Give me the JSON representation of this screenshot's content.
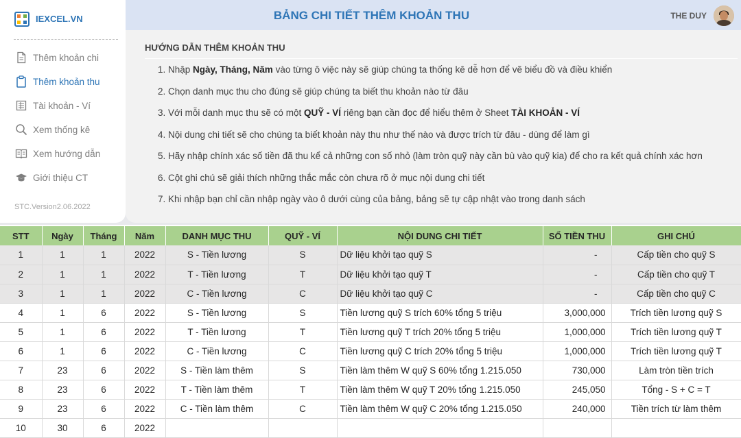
{
  "brand": {
    "name": "IEXCEL.VN"
  },
  "sidebar": {
    "items": [
      {
        "label": "Thêm khoản chi",
        "icon": "document-icon"
      },
      {
        "label": "Thêm khoản thu",
        "icon": "clipboard-icon",
        "active": true
      },
      {
        "label": "Tài khoản - Ví",
        "icon": "ledger-icon"
      },
      {
        "label": "Xem thống kê",
        "icon": "search-icon"
      },
      {
        "label": "Xem hướng dẫn",
        "icon": "book-icon"
      },
      {
        "label": "Giới thiệu CT",
        "icon": "graduation-cap-icon"
      }
    ],
    "version": "STC.Version2.06.2022"
  },
  "header": {
    "title": "BẢNG CHI TIẾT THÊM KHOẢN THU",
    "user": "THE DUY"
  },
  "guide": {
    "title": "HƯỚNG DẪN THÊM KHOẢN THU",
    "items": [
      [
        "1. Nhập ",
        "Ngày, Tháng, Năm",
        " vào từng ô việc này sẽ giúp chúng ta thống kê dễ hơn để vẽ biểu đồ và điều khiển"
      ],
      [
        "2. Chọn danh mục thu cho đúng sẽ giúp chúng ta biết thu khoản nào từ đâu"
      ],
      [
        "3. Với mỗi danh mục thu sẽ có một ",
        "QUỸ - VÍ",
        " riêng bạn cần đọc để hiểu thêm ở Sheet ",
        "TÀI KHOẢN - VÍ"
      ],
      [
        "4. Nội dung chi tiết sẽ cho chúng ta biết khoản này thu như thế nào và được trích từ đâu - dùng để làm gì"
      ],
      [
        "5. Hãy nhập chính xác số tiền đã thu kể cả những con số nhỏ (làm tròn quỹ này cần bù vào quỹ kia) để cho ra kết quả chính xác hơn"
      ],
      [
        "6. Cột ghi chú sẽ giải thích những thắc mắc còn chưa rõ ở mục nội dung chi tiết"
      ],
      [
        "7. Khi nhập bạn chỉ cần nhập ngày vào ô dưới cùng của bảng, bảng sẽ tự cập nhật vào trong danh sách"
      ]
    ]
  },
  "table": {
    "headers": [
      "STT",
      "Ngày",
      "Tháng",
      "Năm",
      "DANH MỤC THU",
      "QUỸ - VÍ",
      "NỘI DUNG CHI TIẾT",
      "SỐ TIỀN THU",
      "GHI CHÚ"
    ],
    "rows": [
      {
        "cells": [
          "1",
          "1",
          "1",
          "2022",
          "S - Tiền lương",
          "S",
          "Dữ liệu khởi tạo quỹ S",
          "-",
          "Cấp tiền cho quỹ S"
        ],
        "init": true
      },
      {
        "cells": [
          "2",
          "1",
          "1",
          "2022",
          "T - Tiền lương",
          "T",
          "Dữ liệu khởi tạo quỹ T",
          "-",
          "Cấp tiền cho quỹ T"
        ],
        "init": true
      },
      {
        "cells": [
          "3",
          "1",
          "1",
          "2022",
          "C - Tiền lương",
          "C",
          "Dữ liệu khởi tạo quỹ C",
          "-",
          "Cấp tiền cho quỹ C"
        ],
        "init": true
      },
      {
        "cells": [
          "4",
          "1",
          "6",
          "2022",
          "S - Tiền lương",
          "S",
          "Tiền lương quỹ S trích 60% tổng 5 triệu",
          "3,000,000",
          "Trích tiền lương quỹ S"
        ]
      },
      {
        "cells": [
          "5",
          "1",
          "6",
          "2022",
          "T - Tiền lương",
          "T",
          "Tiền lương quỹ T trích 20% tổng 5 triệu",
          "1,000,000",
          "Trích tiền lương quỹ T"
        ]
      },
      {
        "cells": [
          "6",
          "1",
          "6",
          "2022",
          "C - Tiền lương",
          "C",
          "Tiền lương quỹ C trích 20% tổng 5 triệu",
          "1,000,000",
          "Trích tiền lương quỹ T"
        ]
      },
      {
        "cells": [
          "7",
          "23",
          "6",
          "2022",
          "S - Tiền làm thêm",
          "S",
          "Tiền làm thêm W quỹ S 60% tổng 1.215.050",
          "730,000",
          "Làm tròn tiền trích"
        ]
      },
      {
        "cells": [
          "8",
          "23",
          "6",
          "2022",
          "T - Tiền làm thêm",
          "T",
          "Tiền làm thêm W quỹ T 20% tổng 1.215.050",
          "245,050",
          "Tổng - S + C = T"
        ]
      },
      {
        "cells": [
          "9",
          "23",
          "6",
          "2022",
          "C - Tiền làm thêm",
          "C",
          "Tiền làm thêm W quỹ C 20% tổng 1.215.050",
          "240,000",
          "Tiền trích từ làm thêm"
        ]
      },
      {
        "cells": [
          "10",
          "30",
          "6",
          "2022",
          "",
          "",
          "",
          "",
          ""
        ]
      }
    ]
  },
  "colors": {
    "accent": "#2e75b6",
    "header_green": "#a9d18e",
    "init_row": "#e7e6e6",
    "panel": "#f2f2f2",
    "title_bar": "#dae3f3"
  }
}
